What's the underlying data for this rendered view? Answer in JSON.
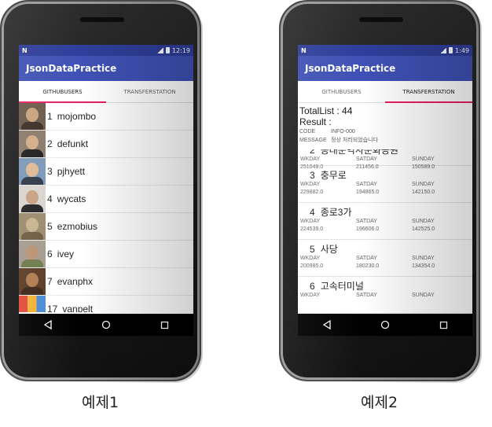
{
  "left_phone": {
    "status": {
      "n": "N",
      "time": "12:19"
    },
    "app_title": "JsonDataPractice",
    "tabs": [
      "GITHUBUSERS",
      "TRANSFERSTATION"
    ],
    "active_tab": 0,
    "users": [
      {
        "idx": "1",
        "name": "mojombo"
      },
      {
        "idx": "2",
        "name": "defunkt"
      },
      {
        "idx": "3",
        "name": "pjhyett"
      },
      {
        "idx": "4",
        "name": "wycats"
      },
      {
        "idx": "5",
        "name": "ezmobius"
      },
      {
        "idx": "6",
        "name": "ivey"
      },
      {
        "idx": "7",
        "name": "evanphx"
      },
      {
        "idx": "17",
        "name": "vanpelt"
      }
    ],
    "caption": "예제1"
  },
  "right_phone": {
    "status": {
      "n": "N",
      "time": "1:49"
    },
    "app_title": "JsonDataPractice",
    "tabs": [
      "GITHUBUSERS",
      "TRANSFERSTATION"
    ],
    "active_tab": 1,
    "total_list": "TotalList :  44",
    "result": "Result :",
    "code_label": "CODE",
    "code_value": "INFO-000",
    "message_label": "MESSAGE",
    "message_value": "정상 처리되었습니다",
    "col_headers": [
      "WKDAY",
      "SATDAY",
      "SUNDAY"
    ],
    "stations": [
      {
        "idx": "2",
        "name": "동대문역사문화공원",
        "wkday": "251049.0",
        "satday": "211456.0",
        "sunday": "150589.0"
      },
      {
        "idx": "3",
        "name": "충무로",
        "wkday": "229882.0",
        "satday": "194865.0",
        "sunday": "142150.0"
      },
      {
        "idx": "4",
        "name": "종로3가",
        "wkday": "224539.0",
        "satday": "196606.0",
        "sunday": "142525.0"
      },
      {
        "idx": "5",
        "name": "사당",
        "wkday": "200985.0",
        "satday": "180230.0",
        "sunday": "134354.0"
      },
      {
        "idx": "6",
        "name": "고속터미널",
        "wkday": "",
        "satday": "",
        "sunday": ""
      }
    ],
    "caption": "예제2"
  },
  "colors": {
    "appbar": "#3f51b5",
    "statusbar": "#2f3e99",
    "tab_indicator": "#e91e63"
  }
}
